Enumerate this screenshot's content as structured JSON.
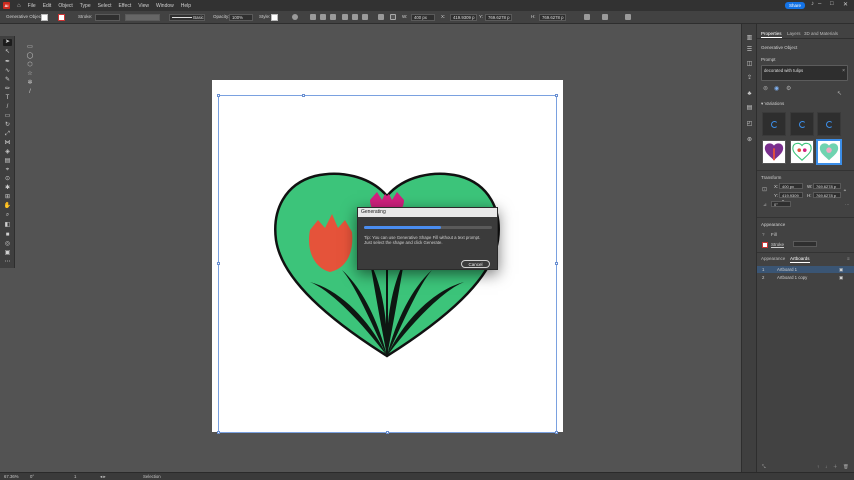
{
  "menubar": {
    "app_icon": "Ai",
    "items": [
      "File",
      "Edit",
      "Object",
      "Type",
      "Select",
      "Effect",
      "View",
      "Window",
      "Help"
    ],
    "share_label": "Share"
  },
  "controlbar": {
    "selection_label": "Generative Object",
    "stroke_label": "Stroke:",
    "brush_label": "Basic",
    "opacity_label": "Opacity:",
    "opacity_value": "100%",
    "style_label": "Style:",
    "w_value": "400 px",
    "x_value": "419.9309 p",
    "y_value": "769.6278 p",
    "h_value": "769.6278 p"
  },
  "dialog": {
    "title": "Generating",
    "progress_fraction": 0.6,
    "tip": "Tip: You can use Generative Shape Fill without a text prompt. Just select the shape and click Generate.",
    "cancel_label": "Cancel"
  },
  "panel": {
    "tabs": [
      "Properties",
      "Layers",
      "3D and Materials"
    ],
    "object_type": "Generative Object",
    "prompt_label": "Prompt",
    "prompt_value": "decorated with tulips",
    "variations_label": "Variations",
    "transform_label": "Transform",
    "t_x": "400 px",
    "t_w": "769.6278 p",
    "t_y": "419.9309 p",
    "t_h": "769.6278 p",
    "t_angle": "0°",
    "appearance_label": "Appearance",
    "fill_label": "Fill",
    "stroke_label": "Stroke",
    "bottom_tabs": [
      "Appearance",
      "Artboards"
    ],
    "artboards": [
      {
        "num": "1",
        "name": "Artboard 1"
      },
      {
        "num": "2",
        "name": "Artboard 1 copy"
      }
    ]
  },
  "statusbar": {
    "zoom": "67.36%",
    "rotation": "0°",
    "artboard_num": "1",
    "mode": "Selection"
  },
  "colors": {
    "heart_green": "#3cc47a",
    "tulip_red": "#e5533a",
    "tulip_pink": "#d1217f",
    "accent_blue": "#1473e6"
  }
}
